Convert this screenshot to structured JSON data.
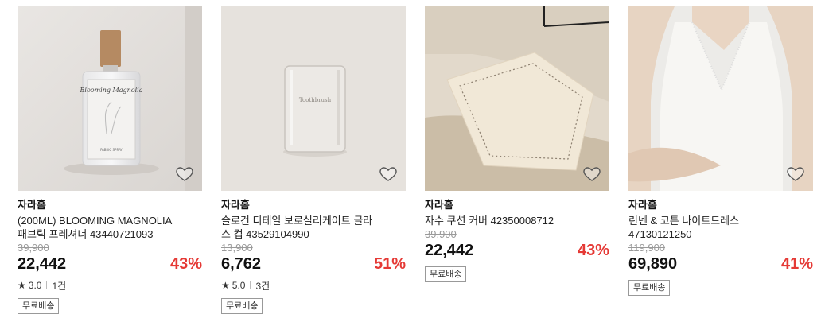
{
  "products": [
    {
      "brand": "자라홈",
      "title": "(200ML) BLOOMING MAGNOLIA 패브릭 프레셔너 43440721093",
      "original_price": "39,900",
      "price": "22,442",
      "discount": "43%",
      "rating": "3.0",
      "reviews": "1건",
      "shipping": "무료배송",
      "label_on_bottle": "Blooming Magnolia",
      "label_bottom": "FABRIC SPRAY"
    },
    {
      "brand": "자라홈",
      "title": "슬로건 디테일 보로실리케이트 글라스 컵 43529104990",
      "original_price": "13,900",
      "price": "6,762",
      "discount": "51%",
      "rating": "5.0",
      "reviews": "3건",
      "shipping": "무료배송",
      "label_on_glass": "Toothbrush"
    },
    {
      "brand": "자라홈",
      "title": "자수 쿠션 커버 42350008712",
      "original_price": "39,900",
      "price": "22,442",
      "discount": "43%",
      "shipping": "무료배송"
    },
    {
      "brand": "자라홈",
      "title": "린넨 & 코튼 나이트드레스 47130121250",
      "original_price": "119,900",
      "price": "69,890",
      "discount": "41%",
      "shipping": "무료배송"
    }
  ]
}
